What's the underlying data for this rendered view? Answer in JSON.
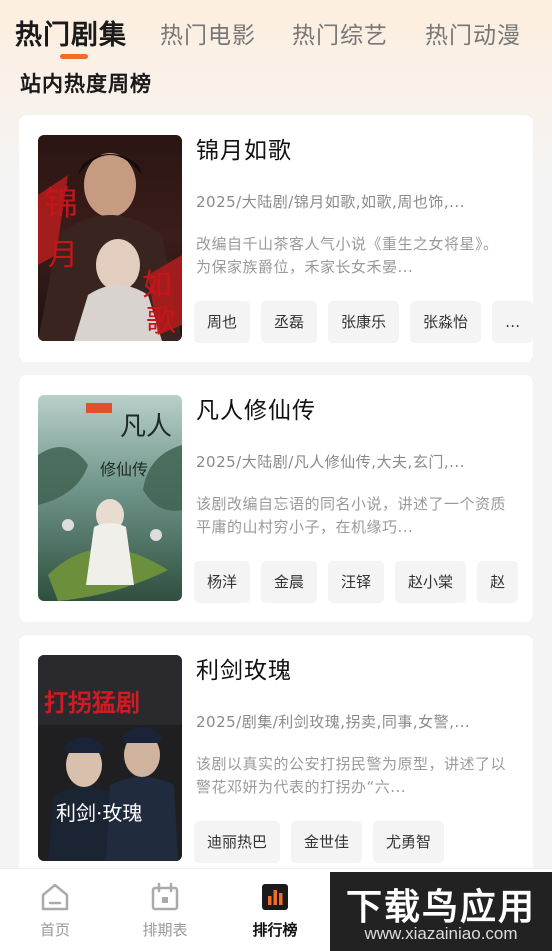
{
  "tabs": [
    {
      "label": "热门剧集",
      "active": true
    },
    {
      "label": "热门电影",
      "active": false
    },
    {
      "label": "热门综艺",
      "active": false
    },
    {
      "label": "热门动漫",
      "active": false
    }
  ],
  "section_title": "站内热度周榜",
  "dramas": [
    {
      "title": "锦月如歌",
      "meta": "2025/大陆剧/锦月如歌,如歌,周也饰,...",
      "description": "改编自千山茶客人气小说《重生之女将星》。为保家族爵位，禾家长女禾晏...",
      "cast": [
        "周也",
        "丞磊",
        "张康乐",
        "张淼怡",
        "…"
      ],
      "poster_text": [
        "锦",
        "月",
        "如",
        "歌"
      ]
    },
    {
      "title": "凡人修仙传",
      "meta": "2025/大陆剧/凡人修仙传,大夫,玄门,...",
      "description": "该剧改编自忘语的同名小说，讲述了一个资质平庸的山村穷小子，在机缘巧...",
      "cast": [
        "杨洋",
        "金晨",
        "汪铎",
        "赵小棠",
        "赵"
      ],
      "poster_text": [
        "凡人",
        "修仙传"
      ]
    },
    {
      "title": "利剑玫瑰",
      "meta": "2025/剧集/利剑玫瑰,拐卖,同事,女警,...",
      "description": "该剧以真实的公安打拐民警为原型，讲述了以警花邓妍为代表的打拐办“六...",
      "cast": [
        "迪丽热巴",
        "金世佳",
        "尤勇智"
      ],
      "poster_text": [
        "打拐猛剧",
        "利剑·玫瑰"
      ]
    }
  ],
  "nav": [
    {
      "label": "首页",
      "icon": "home-icon",
      "active": false
    },
    {
      "label": "排期表",
      "icon": "calendar-icon",
      "active": false
    },
    {
      "label": "排行榜",
      "icon": "ranking-icon",
      "active": true
    }
  ],
  "watermark": {
    "main": "下载鸟应用",
    "sub": "www.xiazainiao.com"
  },
  "colors": {
    "accent": "#f26b2d",
    "card": "#ffffff",
    "page": "#f4f4f4"
  }
}
